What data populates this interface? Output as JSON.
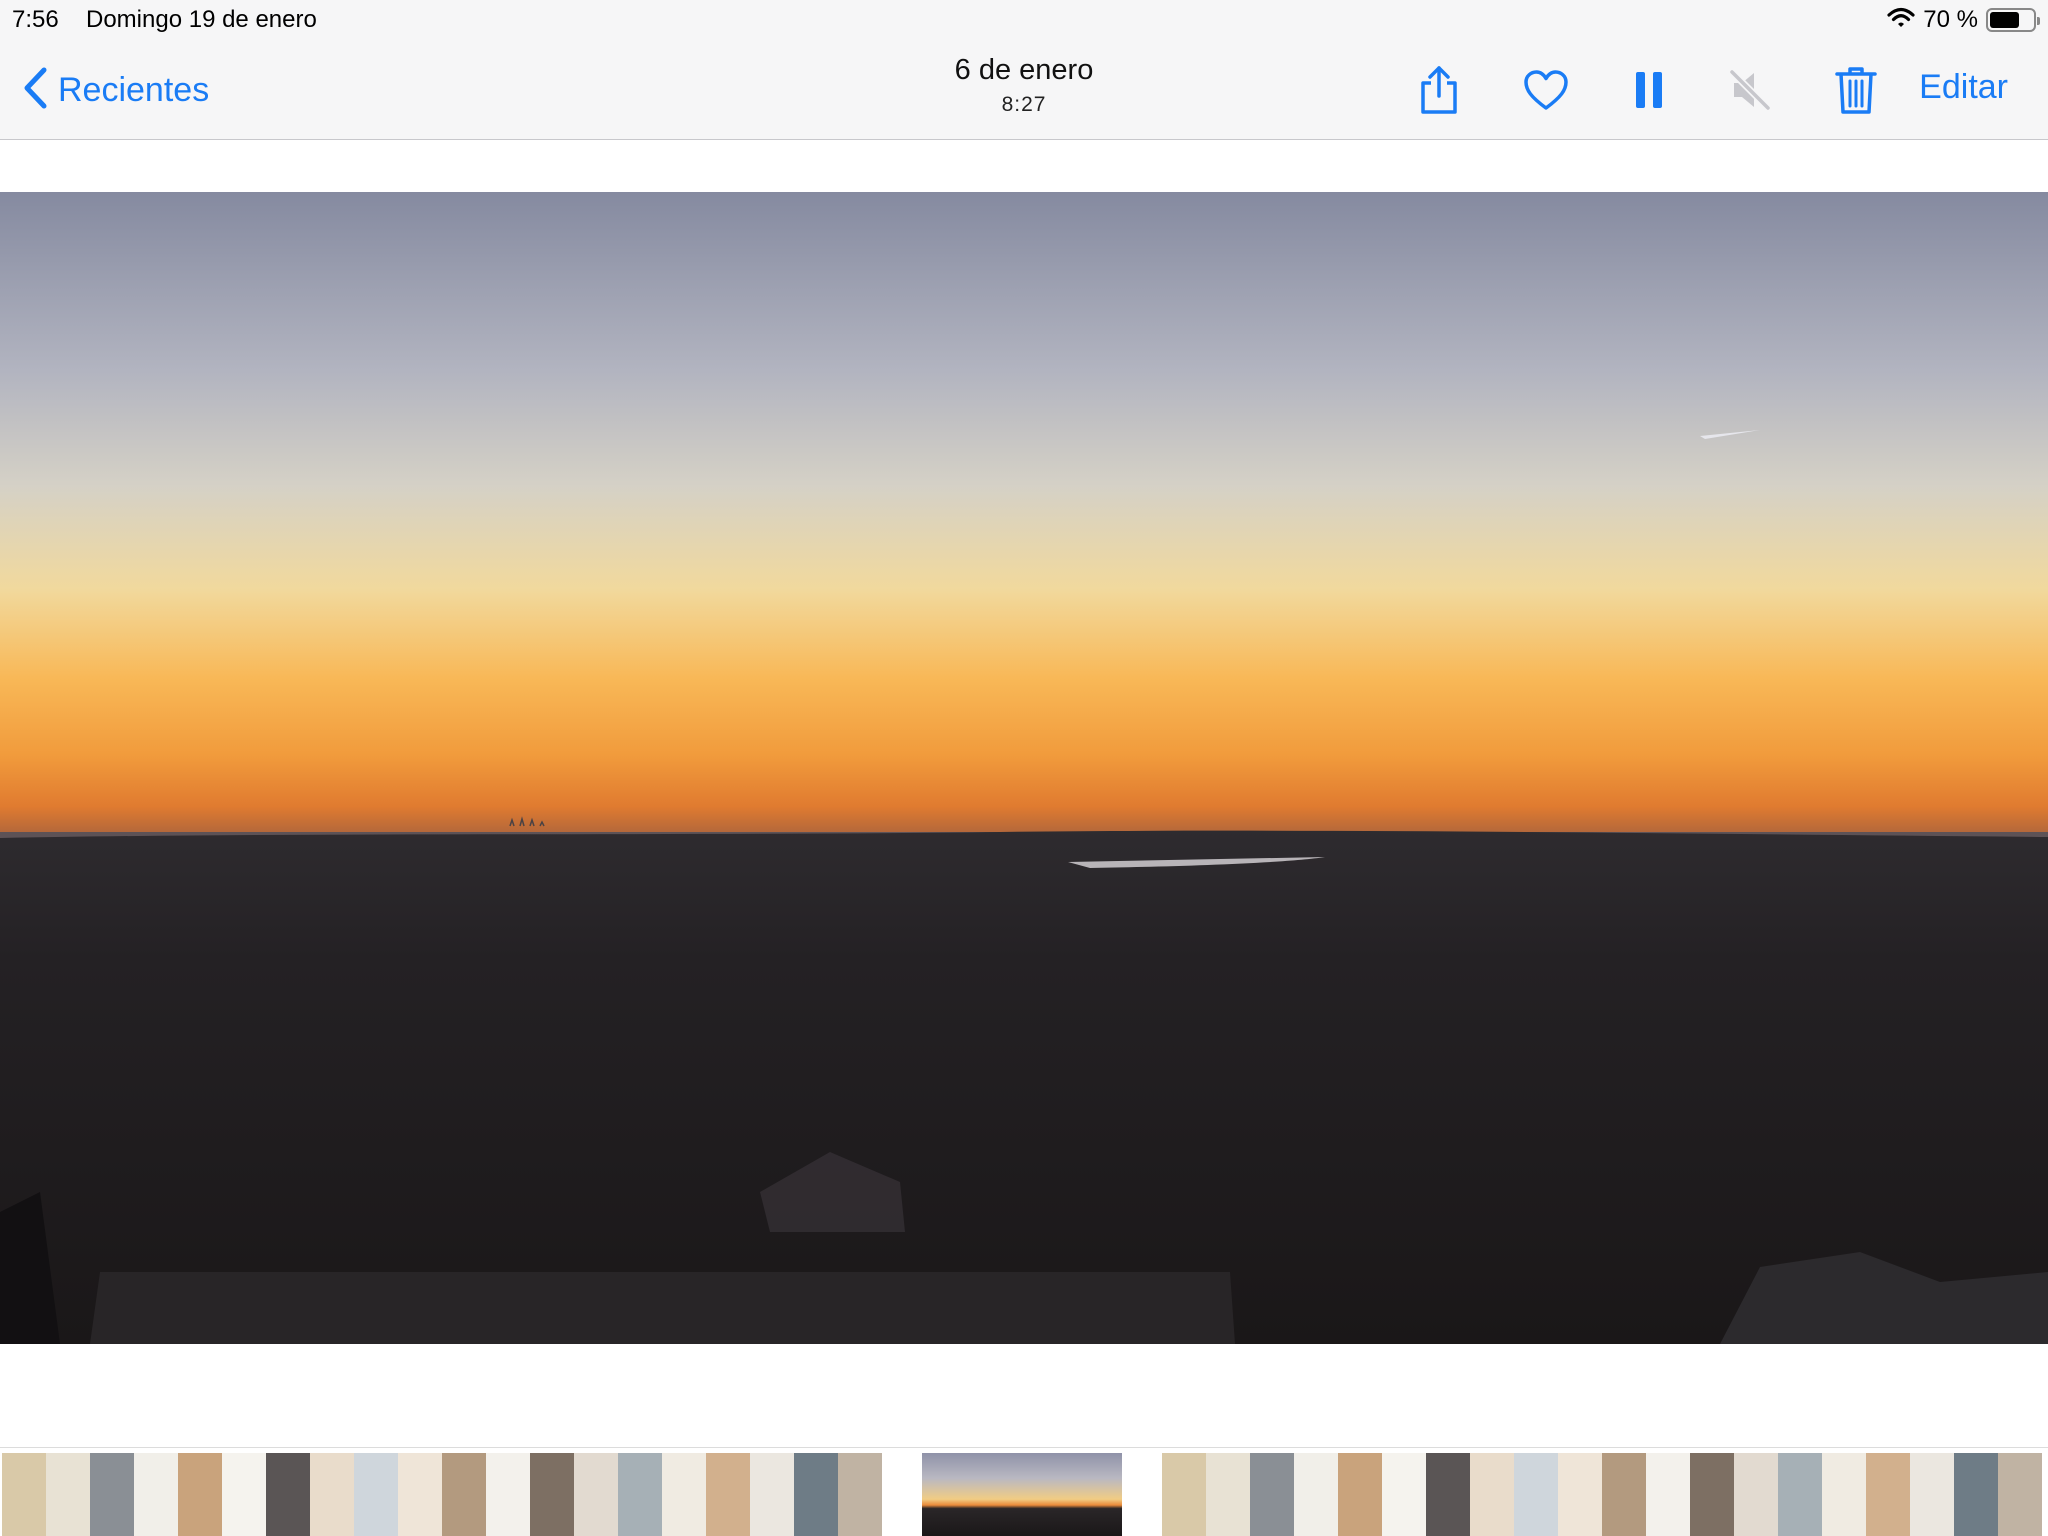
{
  "status_bar": {
    "time": "7:56",
    "date": "Domingo 19 de enero",
    "battery_percent": "70 %",
    "battery_level": 0.7,
    "wifi_icon": "wifi-icon",
    "battery_icon": "battery-icon"
  },
  "nav": {
    "back_label": "Recientes",
    "title": "6 de enero",
    "subtitle": "8:27",
    "edit_label": "Editar",
    "accent_color": "#1a7cf5",
    "tools": [
      "share-icon",
      "heart-icon",
      "pause-icon",
      "mute-icon",
      "trash-icon"
    ]
  },
  "photo": {
    "subject": "sunset-landscape"
  },
  "filmstrip": {
    "thumbnail_count": 40
  }
}
